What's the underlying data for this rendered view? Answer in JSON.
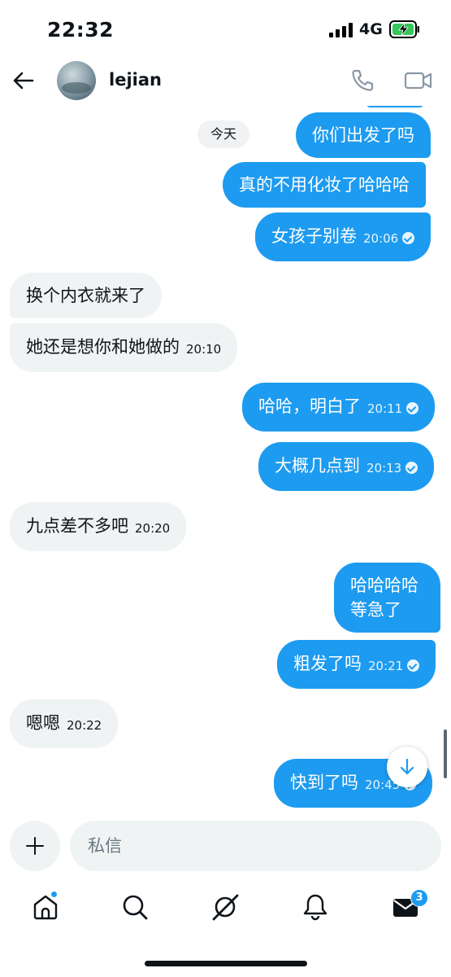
{
  "status_bar": {
    "time": "22:32",
    "network": "4G"
  },
  "header": {
    "contact_name": "lejian"
  },
  "chat": {
    "day_label": "今天",
    "messages": [
      {
        "dir": "out",
        "text": "你们出发了吗",
        "time": ""
      },
      {
        "dir": "out",
        "text": "真的不用化妆了哈哈哈",
        "time": ""
      },
      {
        "dir": "out",
        "text": "女孩子别卷",
        "time": "20:06"
      },
      {
        "dir": "in",
        "text": "换个内衣就来了",
        "time": ""
      },
      {
        "dir": "in",
        "text": "她还是想你和她做的",
        "time": "20:10"
      },
      {
        "dir": "out",
        "text": "哈哈，明白了",
        "time": "20:11"
      },
      {
        "dir": "out",
        "text": "大概几点到",
        "time": "20:13"
      },
      {
        "dir": "in",
        "text": "九点差不多吧",
        "time": "20:20"
      },
      {
        "dir": "out",
        "text_line1": "哈哈哈哈",
        "text_line2": "等急了",
        "time": ""
      },
      {
        "dir": "out",
        "text": "粗发了吗",
        "time": "20:21"
      },
      {
        "dir": "in",
        "text": "嗯嗯",
        "time": "20:22"
      },
      {
        "dir": "out",
        "text": "快到了吗",
        "time": "20:45"
      }
    ]
  },
  "composer": {
    "placeholder": "私信"
  },
  "tabbar": {
    "items": [
      {
        "icon": "home-icon",
        "has_dot": true
      },
      {
        "icon": "search-icon"
      },
      {
        "icon": "grok-icon"
      },
      {
        "icon": "bell-icon"
      },
      {
        "icon": "mail-icon",
        "badge": "3"
      }
    ]
  },
  "colors": {
    "accent": "#1d9bf0",
    "incoming_bubble": "#eff3f4",
    "text": "#0f1419"
  }
}
